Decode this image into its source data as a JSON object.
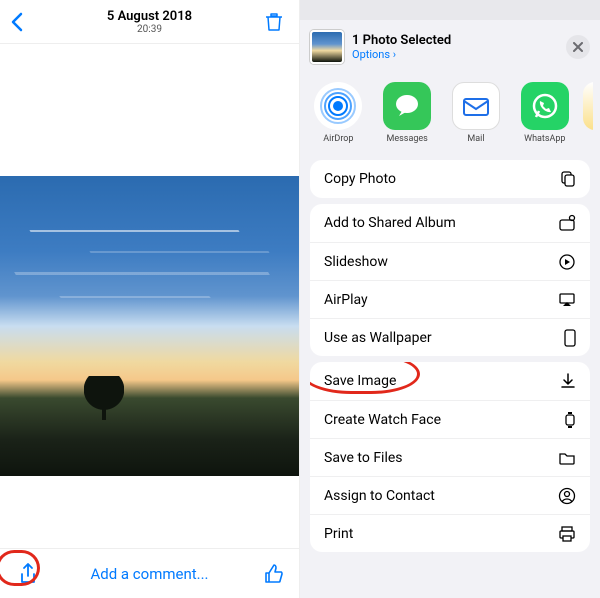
{
  "left": {
    "date": "5 August 2018",
    "time": "20:39",
    "comment_placeholder": "Add a comment..."
  },
  "sheet": {
    "header_title": "1 Photo Selected",
    "header_options": "Options",
    "apps": {
      "airdrop": "AirDrop",
      "messages": "Messages",
      "mail": "Mail",
      "whatsapp": "WhatsApp"
    },
    "group1": [
      {
        "label": "Copy Photo",
        "icon": "copy"
      }
    ],
    "group2": [
      {
        "label": "Add to Shared Album",
        "icon": "shared-album"
      },
      {
        "label": "Slideshow",
        "icon": "play-circle"
      },
      {
        "label": "AirPlay",
        "icon": "airplay"
      },
      {
        "label": "Use as Wallpaper",
        "icon": "phone"
      }
    ],
    "group3": [
      {
        "label": "Save Image",
        "icon": "download"
      },
      {
        "label": "Create Watch Face",
        "icon": "watch"
      },
      {
        "label": "Save to Files",
        "icon": "folder"
      },
      {
        "label": "Assign to Contact",
        "icon": "person"
      },
      {
        "label": "Print",
        "icon": "printer"
      }
    ]
  },
  "annotations": {
    "share_circled": true,
    "save_image_circled": true
  }
}
